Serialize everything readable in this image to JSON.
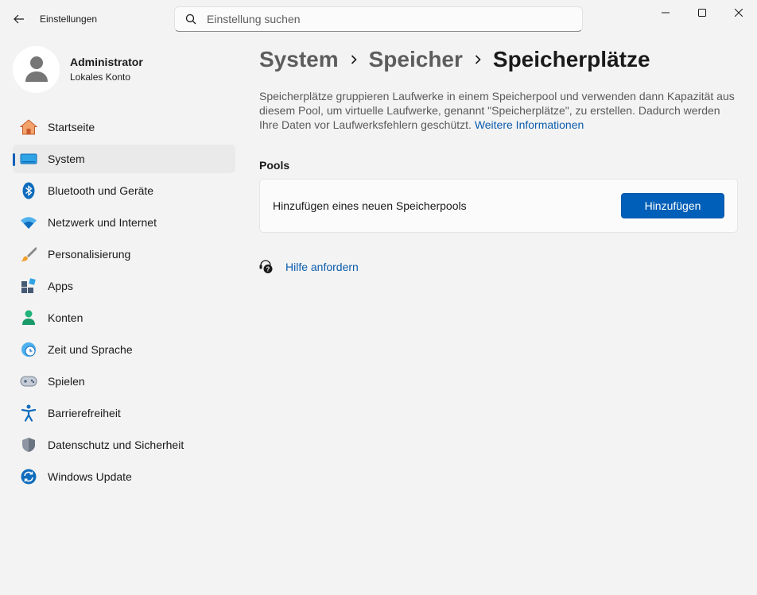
{
  "window": {
    "app_title": "Einstellungen"
  },
  "search": {
    "placeholder": "Einstellung suchen"
  },
  "profile": {
    "name": "Administrator",
    "account_type": "Lokales Konto"
  },
  "sidebar": {
    "items": [
      {
        "label": "Startseite",
        "icon": "home-icon"
      },
      {
        "label": "System",
        "icon": "system-icon",
        "active": true
      },
      {
        "label": "Bluetooth und Geräte",
        "icon": "bluetooth-icon"
      },
      {
        "label": "Netzwerk und Internet",
        "icon": "wifi-icon"
      },
      {
        "label": "Personalisierung",
        "icon": "brush-icon"
      },
      {
        "label": "Apps",
        "icon": "apps-icon"
      },
      {
        "label": "Konten",
        "icon": "account-icon"
      },
      {
        "label": "Zeit und Sprache",
        "icon": "clock-globe-icon"
      },
      {
        "label": "Spielen",
        "icon": "gamepad-icon"
      },
      {
        "label": "Barrierefreiheit",
        "icon": "accessibility-icon"
      },
      {
        "label": "Datenschutz und Sicherheit",
        "icon": "shield-icon"
      },
      {
        "label": "Windows Update",
        "icon": "update-icon"
      }
    ]
  },
  "breadcrumb": {
    "level1": "System",
    "level2": "Speicher",
    "current": "Speicherplätze"
  },
  "main": {
    "description": "Speicherplätze gruppieren Laufwerke in einem Speicherpool und verwenden dann Kapazität aus diesem Pool, um virtuelle Laufwerke, genannt \"Speicherplätze\", zu erstellen. Dadurch werden Ihre Daten vor Laufwerksfehlern geschützt.",
    "learn_more": "Weitere Informationen",
    "pools_heading": "Pools",
    "add_pool_label": "Hinzufügen eines neuen Speicherpools",
    "add_button": "Hinzufügen",
    "help_link": "Hilfe anfordern"
  },
  "colors": {
    "accent": "#005fb8",
    "link": "#0b5cad",
    "background": "#f3f3f3"
  }
}
